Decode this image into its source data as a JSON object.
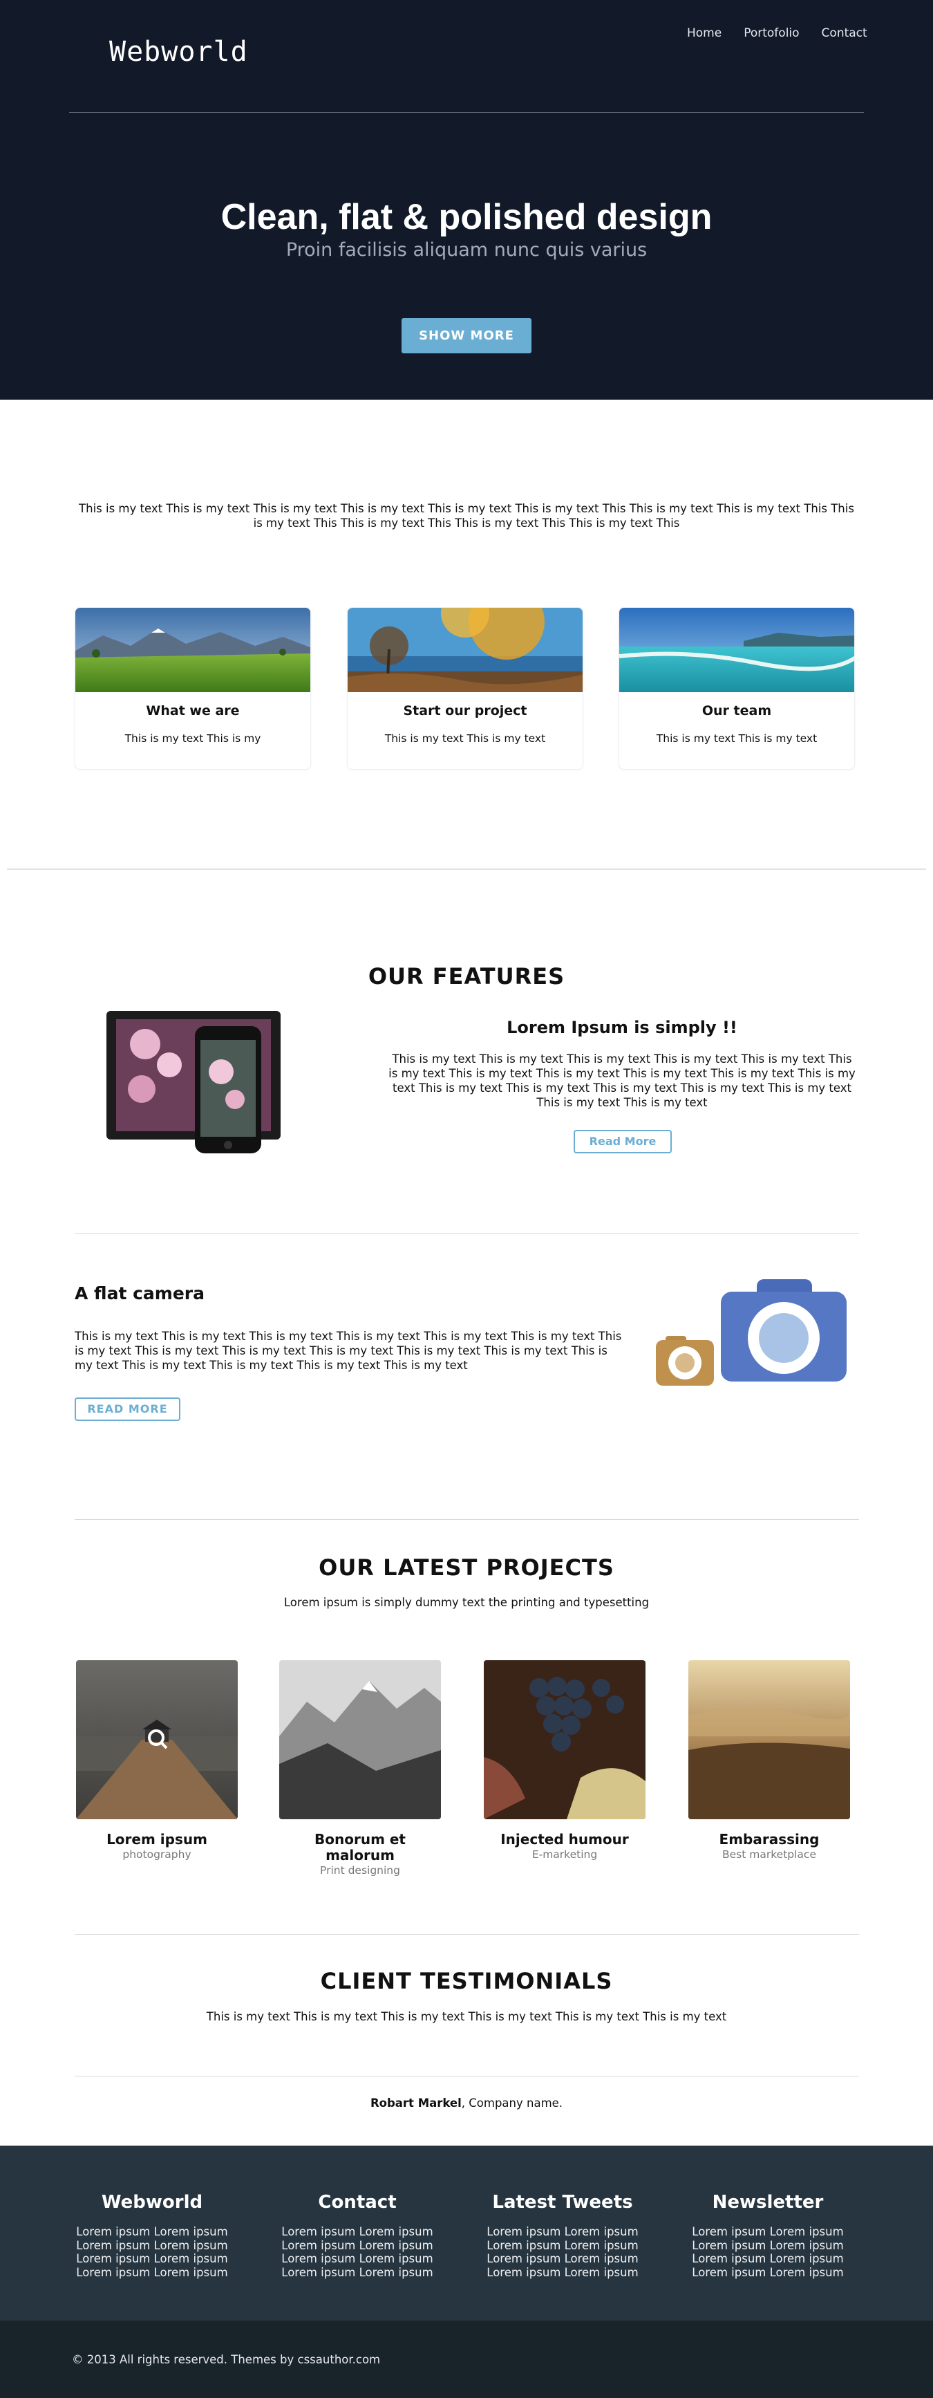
{
  "header": {
    "brand": "Webworld",
    "nav": [
      "Home",
      "Portofolio",
      "Contact"
    ]
  },
  "hero": {
    "title": "Clean, flat & polished design",
    "subtitle": "Proin facilisis aliquam nunc quis varius",
    "button": "SHOW MORE"
  },
  "intro": {
    "text": "This is my text This is my text This is my text This is my text This is my text This is my text This This is my text This is my text This This is my text This This is my text This This is my text This This is my text This"
  },
  "cards": [
    {
      "title": "What we are",
      "text": "This is my text This is my"
    },
    {
      "title": "Start our project",
      "text": "This is my text This is my text"
    },
    {
      "title": "Our team",
      "text": "This is my text This is my text"
    }
  ],
  "features": {
    "title": "OUR FEATURES",
    "heading": "Lorem Ipsum is simply !!",
    "text": "This is my text This is my text This is my text This is my text This is my text This is my text This is my text This is my text This is my text This is my text This is my text This is my text This is my text This is my text This is my text This is my text This is my text This is my text",
    "button": "Read More"
  },
  "camera": {
    "heading": "A flat camera",
    "text": "This is my text This is my text This is my text This is my text This is my text This is my text This is my text This is my text This is my text This is my text This is my text This is my text This is my text This is my text This is my text This is my text This is my text",
    "button": "READ MORE"
  },
  "projects": {
    "title": "OUR LATEST PROJECTS",
    "subtitle": "Lorem ipsum is simply dummy text the printing and typesetting",
    "items": [
      {
        "title": "Lorem ipsum",
        "subtitle": "photography"
      },
      {
        "title": "Bonorum et malorum",
        "subtitle": "Print designing"
      },
      {
        "title": "Injected humour",
        "subtitle": "E-marketing"
      },
      {
        "title": "Embarassing",
        "subtitle": "Best marketplace"
      }
    ]
  },
  "testimonials": {
    "title": "CLIENT TESTIMONIALS",
    "text": "This is my text This is my text This is my text This is my text This is my text This is my text",
    "author": "Robart Markel",
    "company": ", Company name."
  },
  "footer": {
    "columns": [
      {
        "heading": "Webworld",
        "lines": [
          "Lorem ipsum Lorem ipsum",
          "Lorem ipsum Lorem ipsum",
          "Lorem ipsum Lorem ipsum",
          "Lorem ipsum Lorem ipsum"
        ]
      },
      {
        "heading": "Contact",
        "lines": [
          "Lorem ipsum Lorem ipsum",
          "Lorem ipsum Lorem ipsum",
          "Lorem ipsum Lorem ipsum",
          "Lorem ipsum Lorem ipsum"
        ]
      },
      {
        "heading": "Latest Tweets",
        "lines": [
          "Lorem ipsum Lorem ipsum",
          "Lorem ipsum Lorem ipsum",
          "Lorem ipsum Lorem ipsum",
          "Lorem ipsum Lorem ipsum"
        ]
      },
      {
        "heading": "Newsletter",
        "lines": [
          "Lorem ipsum Lorem ipsum",
          "Lorem ipsum Lorem ipsum",
          "Lorem ipsum Lorem ipsum",
          "Lorem ipsum Lorem ipsum"
        ]
      }
    ],
    "copyright": "© 2013 All rights reserved. Themes by cssauthor.com"
  },
  "colors": {
    "hero_bg": "#121a2a",
    "accent": "#6aaed3",
    "footer_bg": "#263540",
    "bottom_bar_bg": "#19232a"
  }
}
